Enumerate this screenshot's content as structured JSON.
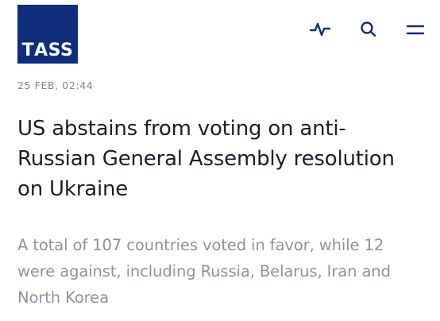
{
  "header": {
    "logo_text": "ТАSS",
    "brand_color": "#0f2d7a",
    "icons": [
      "activity-icon",
      "search-icon",
      "menu-icon"
    ]
  },
  "article": {
    "date": "25 FEB, 02:44",
    "headline": "US abstains from voting on anti-Russian General Assembly resolution on Ukraine",
    "lead": "A total of 107 countries voted in favor, while 12 were against, including Russia, Belarus, Iran and North Korea"
  },
  "colors": {
    "headline": "#1a1f2b",
    "lead": "#8c929d",
    "date": "#7d8593",
    "icons": "#0f2d7a"
  }
}
